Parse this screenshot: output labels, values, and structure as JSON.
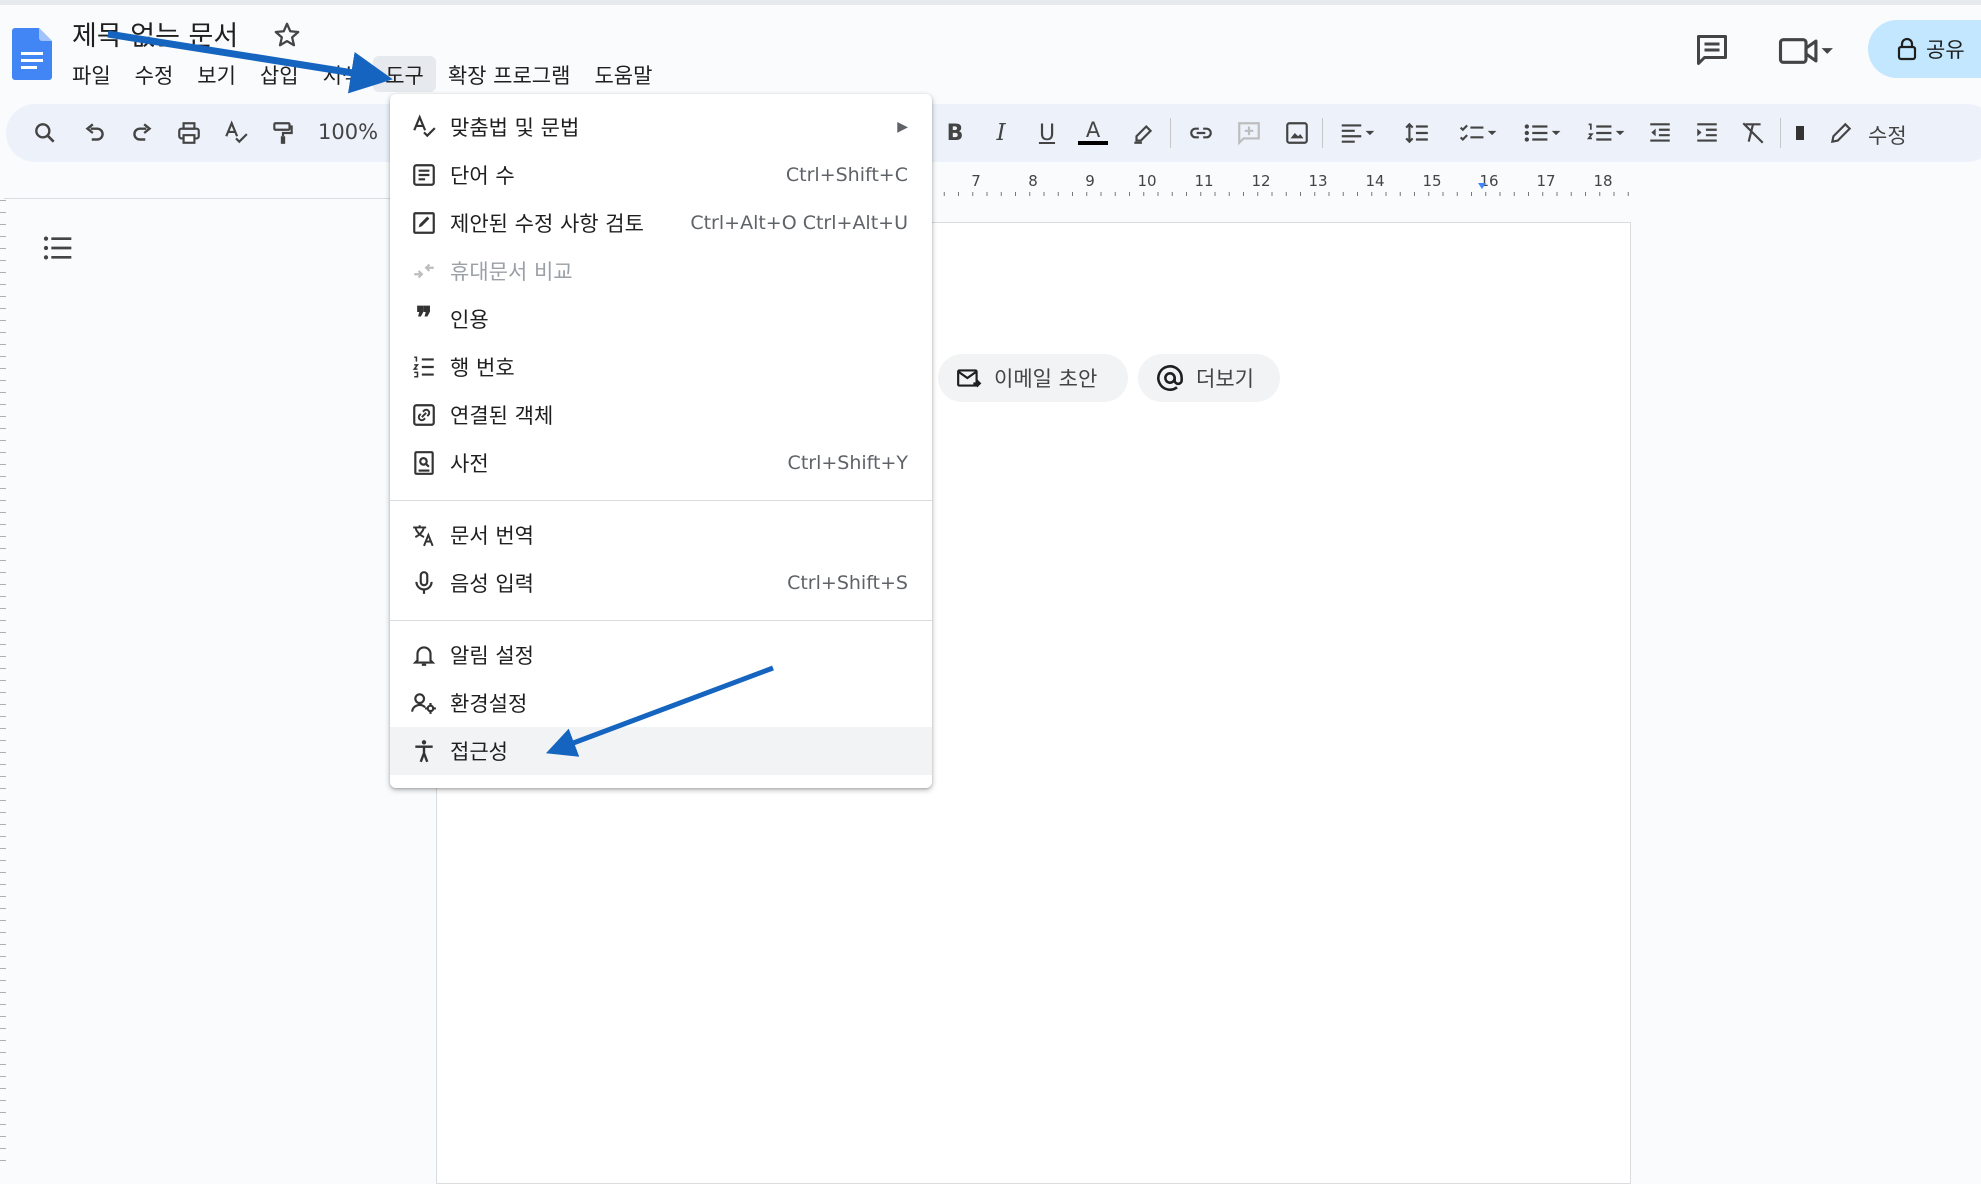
{
  "header": {
    "title": "제목 없는 문서",
    "menus": [
      "파일",
      "수정",
      "보기",
      "삽입",
      "서식",
      "도구",
      "확장 프로그램",
      "도움말"
    ],
    "active_menu_index": 5,
    "share_label": "공유"
  },
  "toolbar": {
    "zoom": "100%",
    "edit_mode_label": "수정",
    "icons": [
      "search-icon",
      "undo-icon",
      "redo-icon",
      "print-icon",
      "spellcheck-icon",
      "paint-format-icon",
      "bold-icon",
      "italic-icon",
      "underline-icon",
      "text-color-icon",
      "highlight-icon",
      "link-icon",
      "comment-icon",
      "image-icon",
      "align-icon",
      "line-spacing-icon",
      "checklist-icon",
      "bullet-list-icon",
      "numbered-list-icon",
      "decrease-indent-icon",
      "increase-indent-icon",
      "clear-formatting-icon",
      "pencil-icon"
    ]
  },
  "ruler": {
    "numbers": [
      "7",
      "8",
      "9",
      "10",
      "11",
      "12",
      "13",
      "14",
      "15",
      "16",
      "17",
      "18"
    ]
  },
  "chips": {
    "email_draft": "이메일 초안",
    "more": "더보기"
  },
  "tools_menu": {
    "items": [
      {
        "icon": "spellcheck-icon",
        "label": "맞춤법 및 문법",
        "shortcut": "",
        "submenu": true
      },
      {
        "icon": "word-count-icon",
        "label": "단어 수",
        "shortcut": "Ctrl+Shift+C"
      },
      {
        "icon": "review-edits-icon",
        "label": "제안된 수정 사항 검토",
        "shortcut": "Ctrl+Alt+O Ctrl+Alt+U"
      },
      {
        "icon": "compare-icon",
        "label": "휴대문서 비교",
        "shortcut": "",
        "disabled": true
      },
      {
        "icon": "citation-icon",
        "label": "인용",
        "shortcut": ""
      },
      {
        "icon": "line-numbers-icon",
        "label": "행 번호",
        "shortcut": ""
      },
      {
        "icon": "linked-objects-icon",
        "label": "연결된 객체",
        "shortcut": ""
      },
      {
        "icon": "dictionary-icon",
        "label": "사전",
        "shortcut": "Ctrl+Shift+Y"
      },
      {
        "icon": "translate-icon",
        "label": "문서 번역",
        "shortcut": ""
      },
      {
        "icon": "microphone-icon",
        "label": "음성 입력",
        "shortcut": "Ctrl+Shift+S"
      },
      {
        "icon": "bell-icon",
        "label": "알림 설정",
        "shortcut": ""
      },
      {
        "icon": "preferences-icon",
        "label": "환경설정",
        "shortcut": ""
      },
      {
        "icon": "accessibility-icon",
        "label": "접근성",
        "shortcut": "",
        "highlighted": true
      }
    ]
  },
  "colors": {
    "arrow": "#1565c0",
    "share_bg": "#c2e7ff",
    "toolbar_bg": "#edf2fa"
  }
}
